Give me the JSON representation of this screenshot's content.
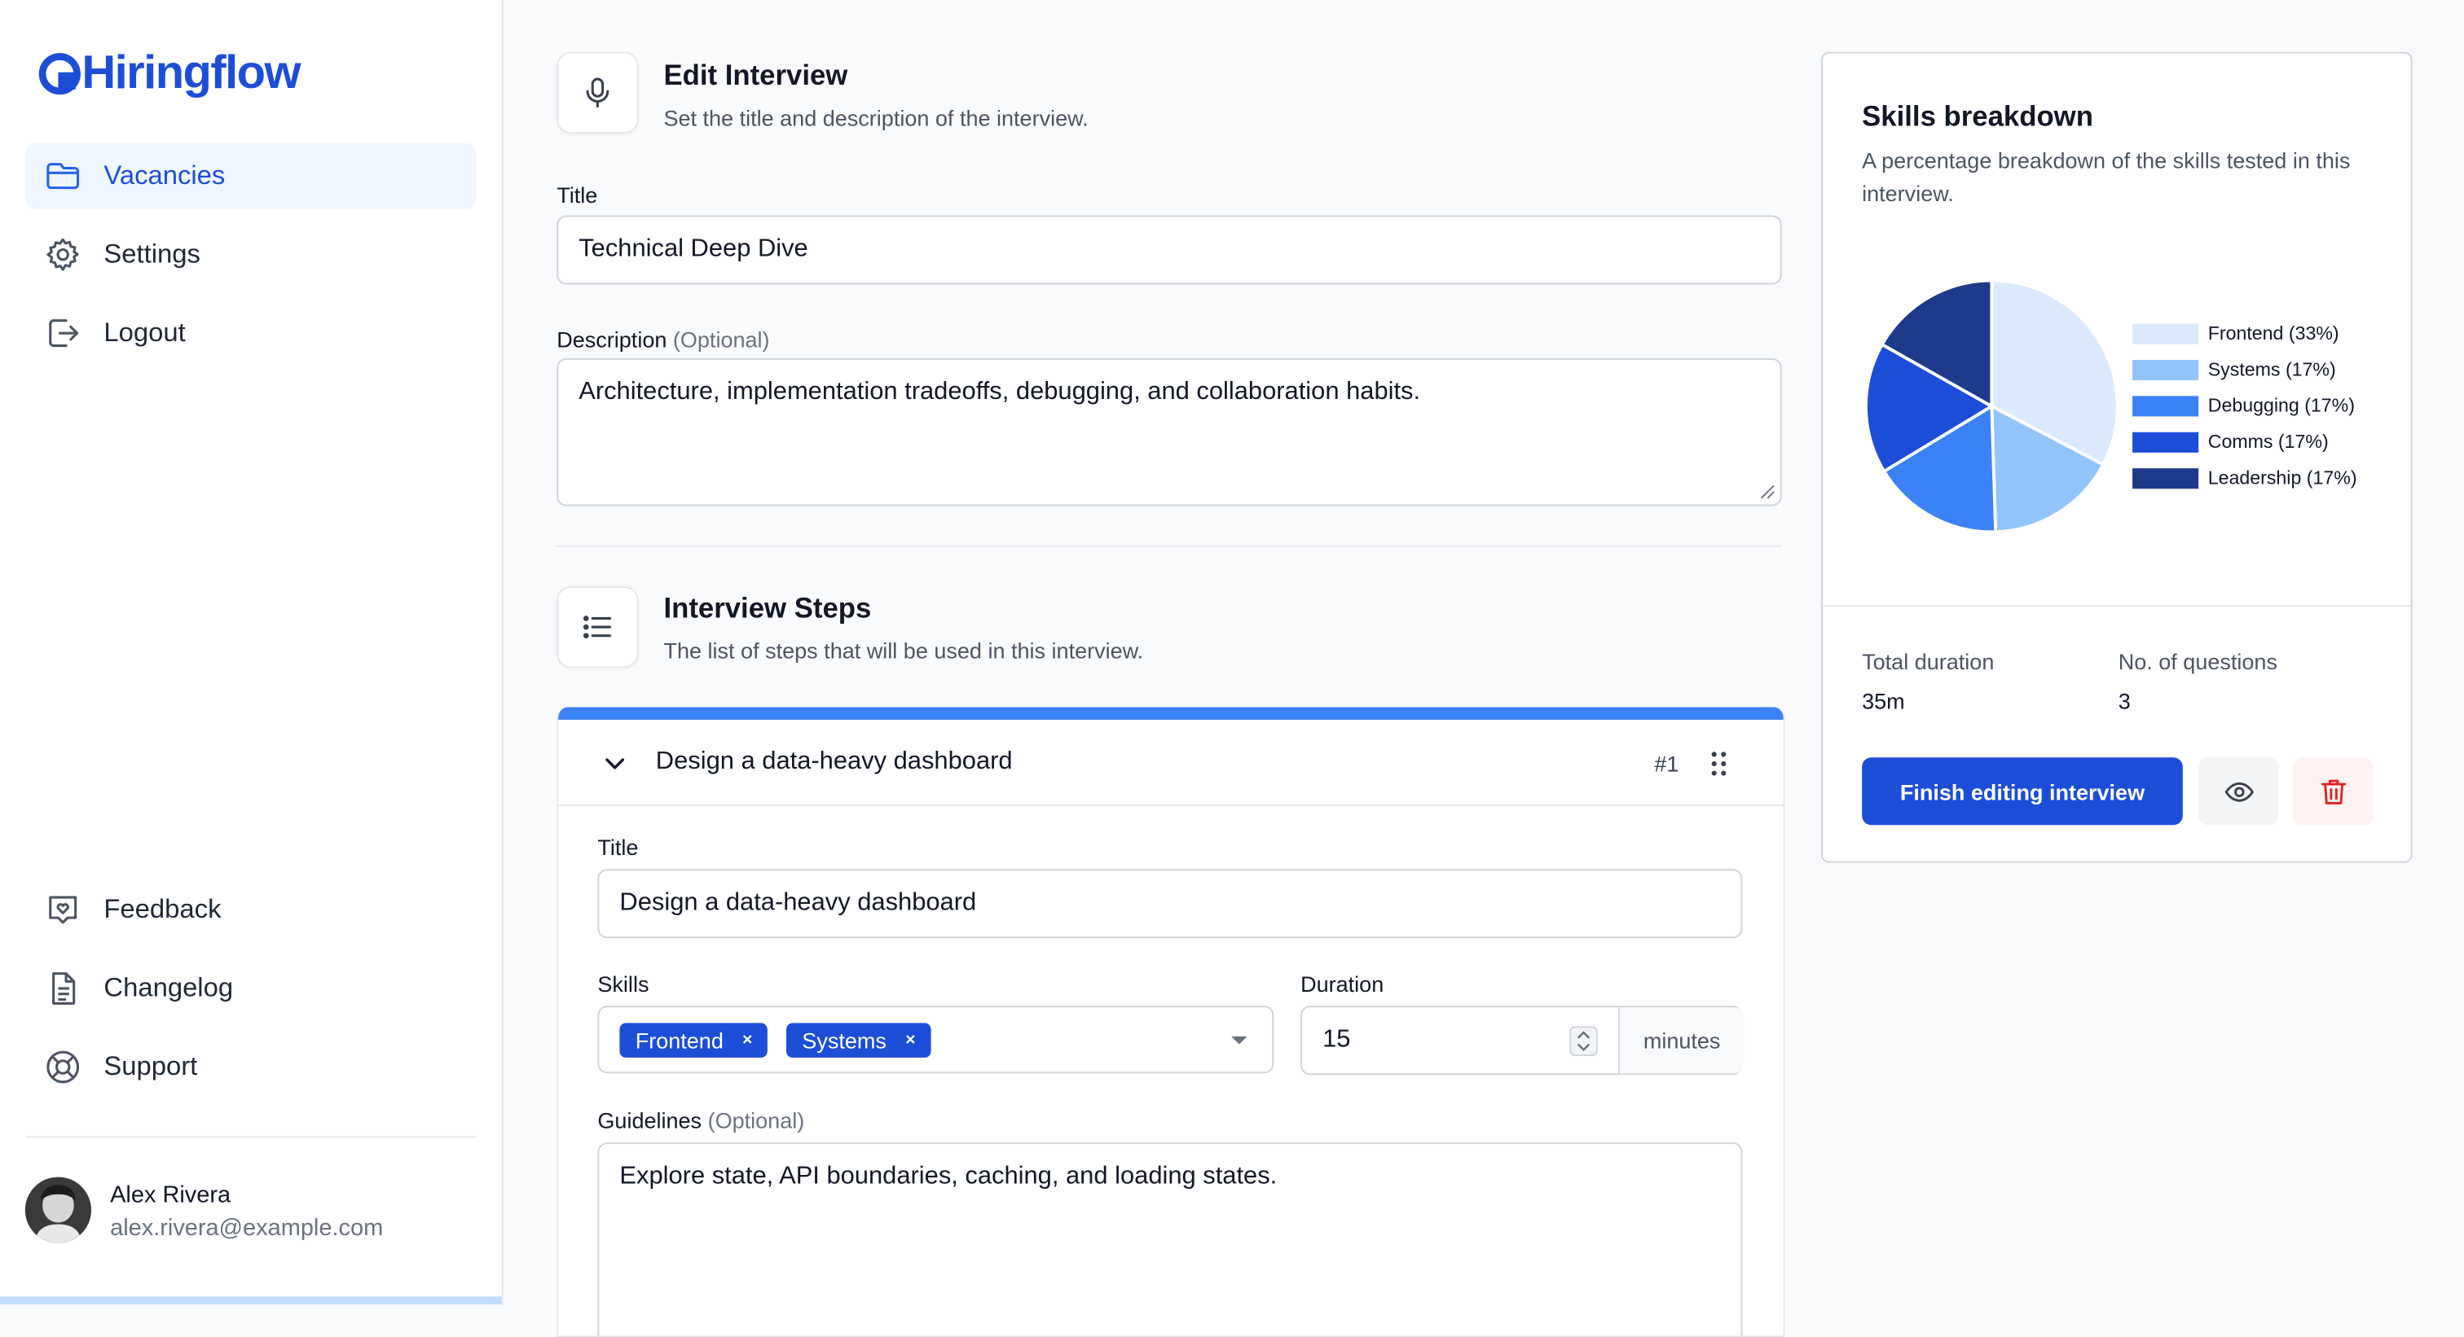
{
  "brand": {
    "name": "Hiringflow",
    "color": "#1d4ed8"
  },
  "sidebar": {
    "nav": [
      {
        "label": "Vacancies",
        "icon": "folder-icon",
        "active": true
      },
      {
        "label": "Settings",
        "icon": "gear-icon"
      },
      {
        "label": "Logout",
        "icon": "logout-icon"
      }
    ],
    "footer_nav": [
      {
        "label": "Feedback",
        "icon": "feedback-icon"
      },
      {
        "label": "Changelog",
        "icon": "document-icon"
      },
      {
        "label": "Support",
        "icon": "lifebuoy-icon"
      }
    ],
    "user": {
      "name": "Alex Rivera",
      "email": "alex.rivera@example.com"
    }
  },
  "edit_interview": {
    "heading": "Edit Interview",
    "subheading": "Set the title and description of the interview.",
    "title_label": "Title",
    "title_value": "Technical Deep Dive",
    "description_label": "Description",
    "optional": "(Optional)",
    "description_value": "Architecture, implementation tradeoffs, debugging, and collaboration habits."
  },
  "steps": {
    "heading": "Interview Steps",
    "subheading": "The list of steps that will be used in this interview.",
    "items": [
      {
        "header_title": "Design a data-heavy dashboard",
        "number": "#1",
        "title_label": "Title",
        "title_value": "Design a data-heavy dashboard",
        "skills_label": "Skills",
        "skills": [
          "Frontend",
          "Systems"
        ],
        "remove_glyph": "×",
        "duration_label": "Duration",
        "duration_value": "15",
        "duration_unit": "minutes",
        "guidelines_label": "Guidelines",
        "guidelines_value": "Explore state, API boundaries, caching, and loading states."
      }
    ]
  },
  "skills_breakdown": {
    "title": "Skills breakdown",
    "subtitle": "A percentage breakdown of the skills tested in this interview.",
    "total_duration_label": "Total duration",
    "total_duration_value": "35m",
    "questions_label": "No. of questions",
    "questions_value": "3",
    "finish_button": "Finish editing interview"
  },
  "chart_data": {
    "type": "pie",
    "labels": [
      "Frontend (33%)",
      "Systems (17%)",
      "Debugging (17%)",
      "Comms (17%)",
      "Leadership (17%)"
    ],
    "values": [
      33,
      17,
      17,
      17,
      17
    ],
    "colors": [
      "#dbeafe",
      "#93c5fd",
      "#3b82f6",
      "#1d4ed8",
      "#1e3a8a"
    ],
    "legend": "right"
  }
}
